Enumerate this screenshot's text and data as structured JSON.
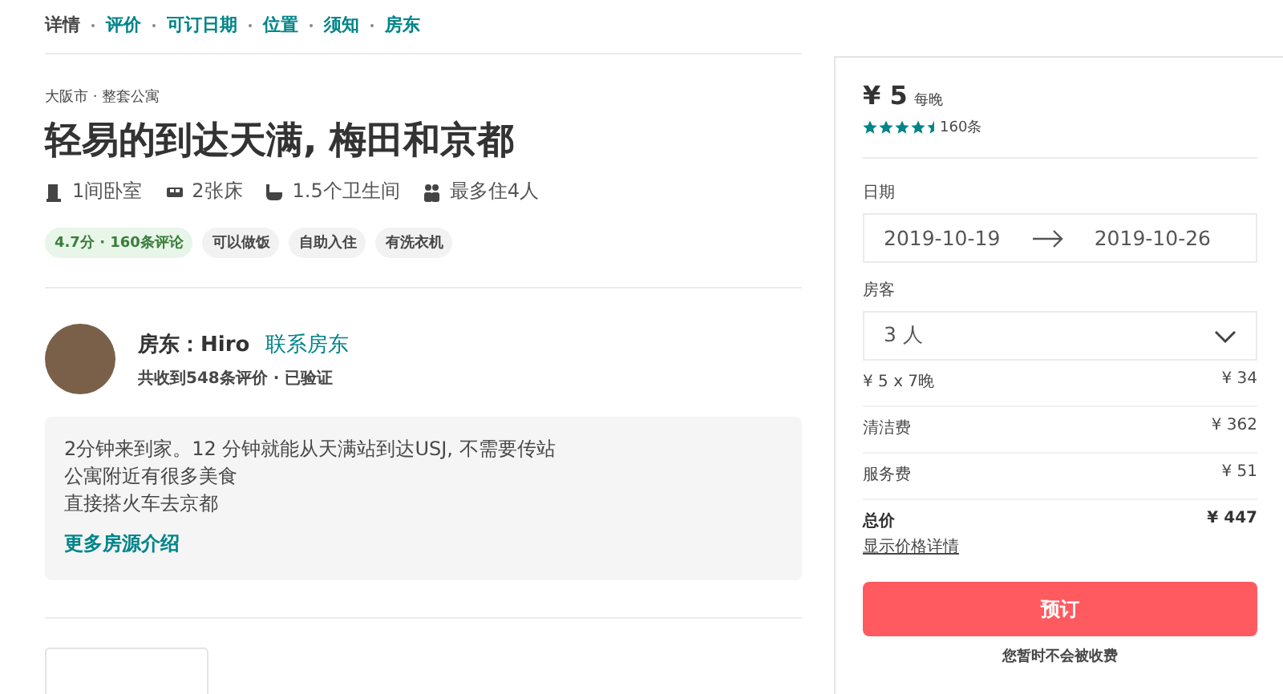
{
  "nav": [
    {
      "label": "详情",
      "selected": true
    },
    {
      "label": "评价",
      "selected": false
    },
    {
      "label": "可订日期",
      "selected": false
    },
    {
      "label": "位置",
      "selected": false
    },
    {
      "label": "须知",
      "selected": false
    },
    {
      "label": "房东",
      "selected": false
    }
  ],
  "listing": {
    "location": "大阪市 · 整套公寓",
    "title": "轻易的到达天满, 梅田和京都",
    "facts": [
      {
        "kind": "bedroom",
        "text": "1间卧室"
      },
      {
        "kind": "bed",
        "text": "2张床"
      },
      {
        "kind": "bath",
        "text": "1.5个卫生间"
      },
      {
        "kind": "guests",
        "text": "最多住4人"
      }
    ],
    "tags": [
      {
        "kind": "rating",
        "text": "4.7分 · 160条评论"
      },
      {
        "kind": "plain",
        "text": "可以做饭"
      },
      {
        "kind": "plain",
        "text": "自助入住"
      },
      {
        "kind": "plain",
        "text": "有洗衣机"
      }
    ]
  },
  "host": {
    "name": "房东：Hiro",
    "contact": "联系房东",
    "stats": "共收到548条评价 · 已验证",
    "description": [
      "2分钟来到家。12 分钟就能从天满站到达USJ, 不需要传站",
      "公寓附近有很多美食",
      "直接搭火车去京都"
    ],
    "more": "更多房源介绍"
  },
  "booking": {
    "price": "¥ 5",
    "per": "每晚",
    "stars": 4.5,
    "reviews": "160条",
    "dates_label": "日期",
    "check_in": "2019-10-19",
    "check_out": "2019-10-26",
    "guests_label": "房客",
    "guests": "3 人",
    "lines": [
      {
        "kind": "normal",
        "label": "¥ 5 x 7晚",
        "amount": "¥ 34"
      },
      {
        "kind": "normal",
        "label": "清洁费",
        "amount": "¥ 362"
      },
      {
        "kind": "normal",
        "label": "服务费",
        "amount": "¥ 51"
      },
      {
        "kind": "total",
        "label": "总价",
        "amount": "¥ 447"
      }
    ],
    "details_link": "显示价格详情",
    "button": "预订",
    "note": "您暂时不会被收费"
  }
}
